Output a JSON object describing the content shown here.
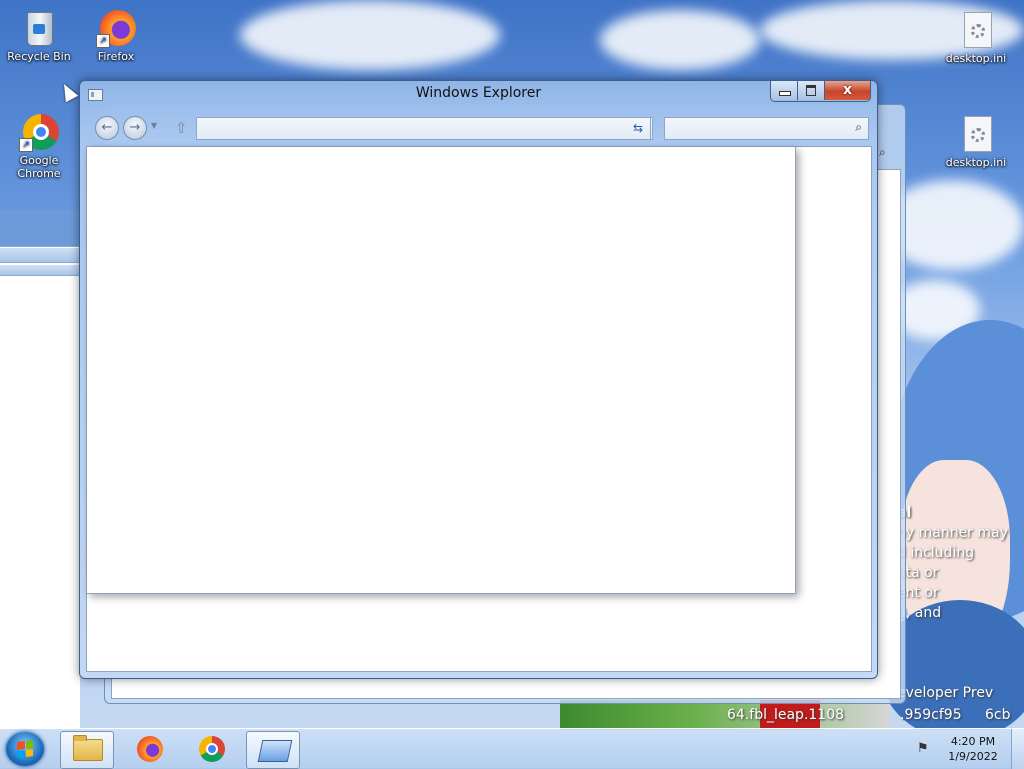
{
  "desktop": {
    "icons": [
      {
        "label": "Recycle Bin"
      },
      {
        "label": "Firefox"
      },
      {
        "label": "Google Chrome"
      },
      {
        "label": "desktop.ini"
      },
      {
        "label": "desktop.ini"
      }
    ],
    "wallpaper_text": [
      "al",
      "ny manner may",
      "d including",
      "ata or",
      "ent or",
      "u, and",
      "eveloper Prev",
      "64.fbl_leap.1108",
      ".959cf95",
      "6cb"
    ]
  },
  "window": {
    "title": "Windows Explorer",
    "address_value": "",
    "search_value": "",
    "caption": {
      "close": "x"
    }
  },
  "taskbar": {
    "items": [
      "Windows Explorer",
      "Firefox",
      "Google Chrome",
      "Internet Explorer"
    ],
    "clock": {
      "time": "4:20 PM",
      "date": "1/9/2022"
    }
  },
  "colors": {
    "accent": "#1d6fbf",
    "close": "#c7452a",
    "titlebar": "#a9c8f0"
  }
}
